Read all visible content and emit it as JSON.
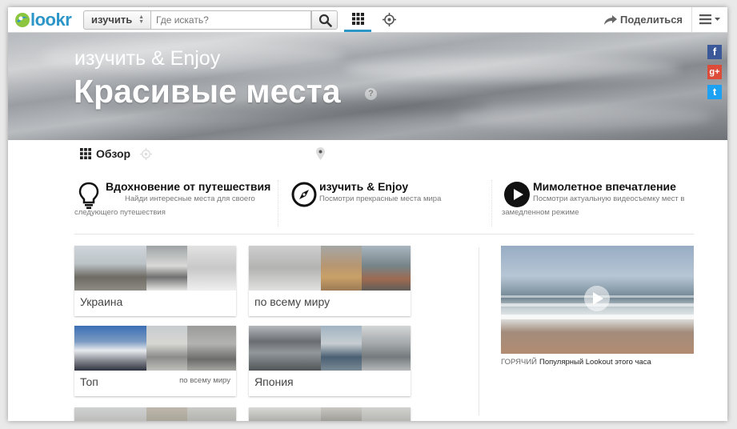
{
  "header": {
    "logo": "lookr",
    "select_value": "изучить",
    "search_placeholder": "Где искать?",
    "share_label": "Поделиться"
  },
  "hero": {
    "subtitle": "изучить & Enjoy",
    "title": "Красивые места",
    "help": "?"
  },
  "social": [
    "f",
    "g+",
    "t"
  ],
  "tabs": [
    {
      "label": "Обзор",
      "icon": "grid-icon",
      "active": true
    },
    {
      "label": "Что находится вокруг меня?",
      "icon": "crosshair-icon",
      "active": false
    },
    {
      "label": "Карта",
      "icon": "map-pin-icon",
      "active": false
    }
  ],
  "features": [
    {
      "title": "Вдохновение от путешествия",
      "desc1": "Найди интересные места для своего",
      "desc2": "следующего путешествия",
      "icon": "lightbulb-icon"
    },
    {
      "title": "изучить & Enjoy",
      "desc1": "Посмотри прекрасные места мира",
      "desc2": "",
      "icon": "compass-icon"
    },
    {
      "title": "Мимолетное впечатление",
      "desc1": "Посмотри актуальную видеосъемку мест в",
      "desc2": "замедленном режиме",
      "icon": "play-circle-icon"
    }
  ],
  "tiles": [
    {
      "label": "Украина",
      "sub": ""
    },
    {
      "label": "по всему миру",
      "sub": ""
    },
    {
      "label": "Топ",
      "sub": "по всему миру"
    },
    {
      "label": "Япония",
      "sub": ""
    }
  ],
  "video": {
    "hot_label": "ГОРЯЧИЙ",
    "caption": "Популярный Lookout этого часа"
  },
  "colors": {
    "accent": "#2d96c8",
    "facebook": "#3b5998",
    "googleplus": "#dd4b39",
    "twitter": "#1da1f2"
  }
}
